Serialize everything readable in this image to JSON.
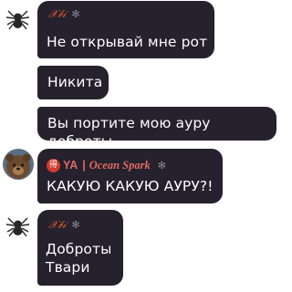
{
  "messages": [
    {
      "sender": "𝒳𝒷𝒾",
      "sender_badge_icon": "spider-icon",
      "text": "Не открывай мне рот",
      "avatar_icon": "spider-avatar"
    },
    {
      "text": "Никита"
    },
    {
      "text": "Вы портите мою ауру доброты"
    },
    {
      "sender_prefix_badge": "得",
      "sender_part1": "YA",
      "sender_separator": "|",
      "sender_part2": "Ocean Spark",
      "sender_badge_icon": "spider-icon",
      "text": "КАКУЮ КАКУЮ АУРУ?!",
      "avatar_icon": "bear-avatar"
    },
    {
      "sender": "𝒳𝒷𝒾",
      "sender_badge_icon": "spider-icon",
      "text": "Доброты\nТвари",
      "avatar_icon": "spider-avatar"
    }
  ],
  "colors": {
    "bubble_background": "#25212d",
    "message_text": "#ffffff",
    "sender_color_xbi": "#d95a2b",
    "sender_color_ocean": "#e06a63"
  }
}
